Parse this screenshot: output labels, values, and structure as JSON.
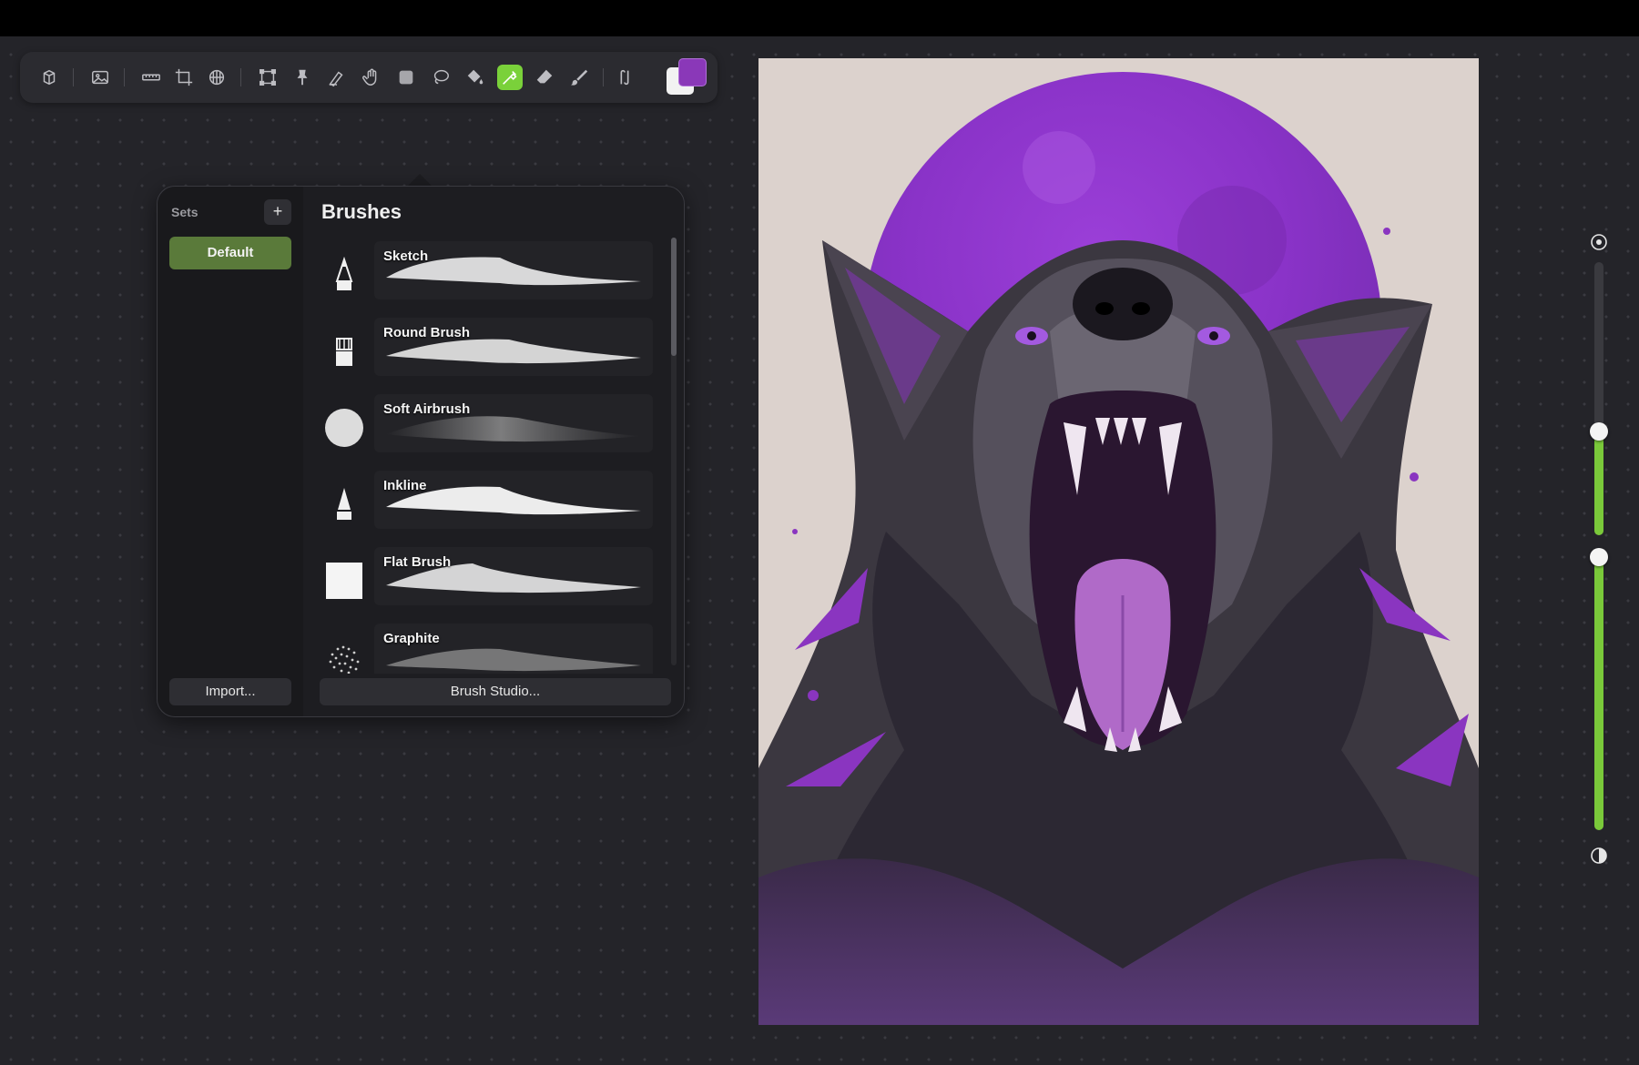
{
  "toolbar": {
    "tools": [
      {
        "name": "gallery-icon"
      },
      {
        "name": "image-icon"
      },
      {
        "name": "ruler-icon"
      },
      {
        "name": "crop-icon"
      },
      {
        "name": "transform-grid-icon"
      },
      {
        "name": "selection-transform-icon"
      },
      {
        "name": "pin-icon"
      },
      {
        "name": "smudge-liquify-icon"
      },
      {
        "name": "hand-icon"
      },
      {
        "name": "layer-square-icon"
      },
      {
        "name": "lasso-icon"
      },
      {
        "name": "paint-bucket-icon"
      },
      {
        "name": "eyedropper-brush-icon",
        "active": true
      },
      {
        "name": "eraser-icon"
      },
      {
        "name": "brush-icon"
      },
      {
        "name": "symmetry-icon"
      }
    ],
    "primary_color": "#8a38b8",
    "secondary_color": "#f2f2f2",
    "active_color": "#7ad13a"
  },
  "brush_panel": {
    "sets_label": "Sets",
    "add_set_label": "+",
    "sets": [
      {
        "label": "Default",
        "selected": true
      }
    ],
    "import_label": "Import...",
    "title": "Brushes",
    "brushes": [
      {
        "name": "Sketch",
        "thumb": "pencil-icon"
      },
      {
        "name": "Round Brush",
        "thumb": "round-brush-icon"
      },
      {
        "name": "Soft Airbrush",
        "thumb": "airbrush-icon"
      },
      {
        "name": "Inkline",
        "thumb": "ink-pen-icon"
      },
      {
        "name": "Flat Brush",
        "thumb": "flat-brush-icon"
      },
      {
        "name": "Graphite",
        "thumb": "graphite-icon"
      }
    ],
    "studio_label": "Brush Studio..."
  },
  "sidebar": {
    "brush_size": 0.38,
    "opacity": 1.0
  }
}
